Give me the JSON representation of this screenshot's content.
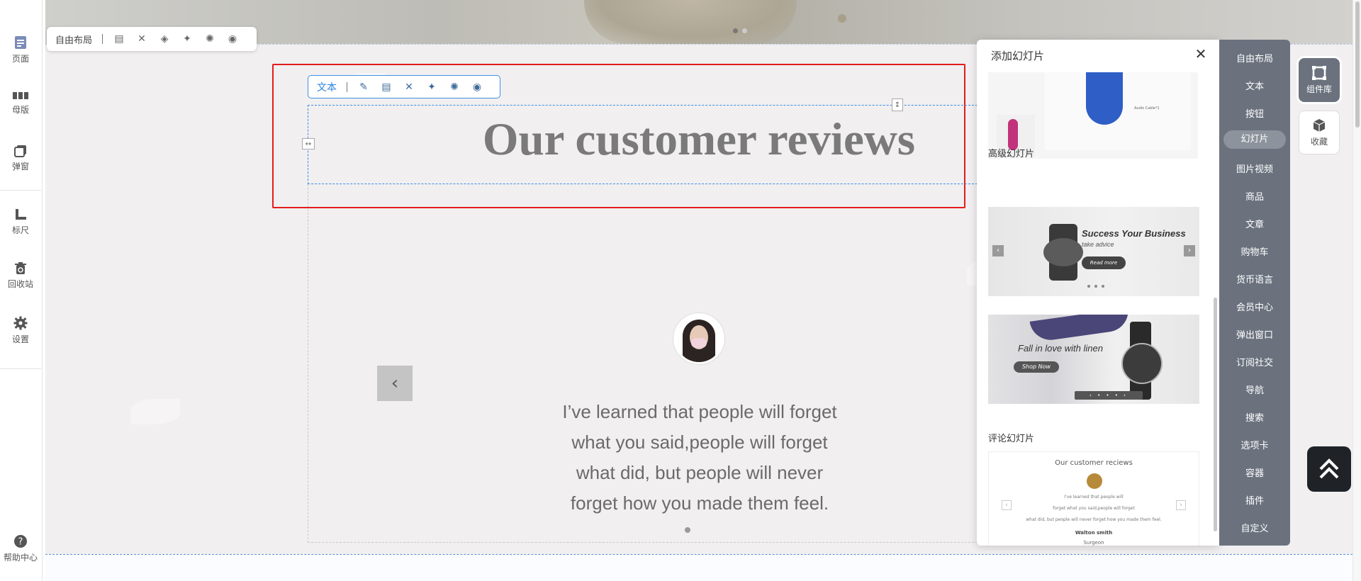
{
  "sidebar": {
    "items": [
      {
        "label": "页面",
        "icon": "page-icon"
      },
      {
        "label": "母版",
        "icon": "master-icon"
      },
      {
        "label": "弹窗",
        "icon": "popup-icon"
      },
      {
        "label": "标尺",
        "icon": "ruler-icon"
      },
      {
        "label": "回收站",
        "icon": "recycle-bin-icon"
      },
      {
        "label": "设置",
        "icon": "gear-icon"
      }
    ],
    "help": {
      "label": "帮助中心",
      "icon": "help-icon"
    }
  },
  "free_toolbar": {
    "label": "自由布局"
  },
  "text_toolbar": {
    "label": "文本"
  },
  "section": {
    "title": "Our customer reviews",
    "quote": "I’ve learned that people will forget what you said,people will forget what did, but people will never forget how you made them feel."
  },
  "panel": {
    "title": "添加幻灯片",
    "advanced_label": "高级幻灯片",
    "review_label": "评论幻灯片",
    "thumb_top_caption": "Audio Cable*1",
    "adv1": {
      "headline": "Success Your Business",
      "sub": "take advice",
      "button": "Read more"
    },
    "adv2": {
      "headline": "Fall in love with linen",
      "button": "Shop Now"
    },
    "review_thumb": {
      "title": "Our customer reciews",
      "line1": "I've learned that people will",
      "line2": "forget what you said,people will forget",
      "line3": "what did, but people will never forget how you made them feel.",
      "name": "Walton smith",
      "job": "Surgeon"
    }
  },
  "categories": [
    "自由布局",
    "文本",
    "按钮",
    "幻灯片",
    "图片视频",
    "商品",
    "文章",
    "购物车",
    "货币语言",
    "会员中心",
    "弹出窗口",
    "订阅社交",
    "导航",
    "搜索",
    "选项卡",
    "容器",
    "插件",
    "自定义"
  ],
  "active_category": "幻灯片",
  "right_tools": {
    "library_label": "组件库",
    "favorites_label": "收藏"
  },
  "colors": {
    "selection_red": "#e31c1c",
    "selection_blue": "#3a8ee6",
    "rail_bg": "#6b727e",
    "title_gray": "#7a7a7a"
  }
}
